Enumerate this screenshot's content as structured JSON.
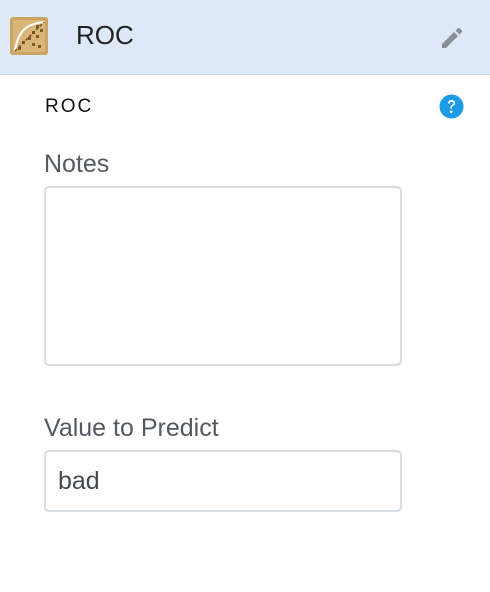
{
  "header": {
    "title": "ROC",
    "node_icon": "roc-curve-icon",
    "edit_icon": "pencil-icon"
  },
  "subtitle": "ROC",
  "help_icon": "question-circle-icon",
  "notes": {
    "label": "Notes",
    "value": ""
  },
  "value_to_predict": {
    "label": "Value to Predict",
    "value": "bad"
  },
  "colors": {
    "header_bg": "#dde9f7",
    "help_blue": "#1e9be6",
    "icon_tan": "#c9a462",
    "pencil_gray": "#8a8f96"
  }
}
